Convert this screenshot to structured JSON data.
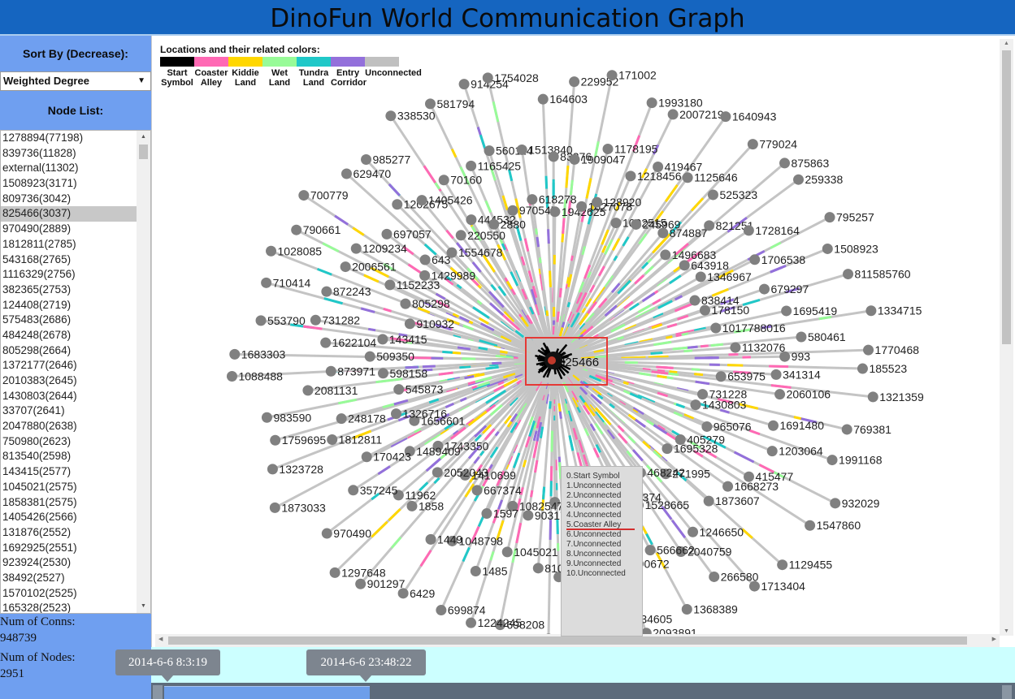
{
  "app": {
    "title": "DinoFun World Communication Graph"
  },
  "sidebar": {
    "sort_label": "Sort By (Decrease):",
    "sort_value": "Weighted Degree",
    "node_list_label": "Node List:",
    "selected_index": 5,
    "nodes": [
      "1278894(77198)",
      "839736(11828)",
      "external(11302)",
      "1508923(3171)",
      "809736(3042)",
      "825466(3037)",
      "970490(2889)",
      "1812811(2785)",
      "543168(2765)",
      "1116329(2756)",
      "382365(2753)",
      "124408(2719)",
      "575483(2686)",
      "484248(2678)",
      "805298(2664)",
      "1372177(2646)",
      "2010383(2645)",
      "1430803(2644)",
      "33707(2641)",
      "2047880(2638)",
      "750980(2623)",
      "813540(2598)",
      "143415(2577)",
      "1045021(2575)",
      "1858381(2575)",
      "1405426(2566)",
      "131876(2552)",
      "1692925(2551)",
      "923924(2530)",
      "38492(2527)",
      "1570102(2525)",
      "165328(2523)"
    ],
    "num_conns_label": "Num of Conns:",
    "num_conns": "948739",
    "num_nodes_label": "Num of Nodes:",
    "num_nodes": "2951"
  },
  "legend": {
    "title": "Locations and their related colors:",
    "items": [
      {
        "line1": "Start",
        "line2": "Symbol",
        "color": "#000000"
      },
      {
        "line1": "Coaster",
        "line2": "Alley",
        "color": "#ff69b4"
      },
      {
        "line1": "Kiddie",
        "line2": "Land",
        "color": "#ffd700"
      },
      {
        "line1": "Wet",
        "line2": "Land",
        "color": "#98fb98"
      },
      {
        "line1": "Tundra",
        "line2": "Land",
        "color": "#20c8c8"
      },
      {
        "line1": "Entry",
        "line2": "Corridor",
        "color": "#9370db"
      },
      {
        "line1": "Unconnected",
        "line2": "",
        "color": "#c0c0c0"
      }
    ]
  },
  "graph": {
    "center_label": "825466",
    "neighbor_labels": [
      "185523",
      "341314",
      "653975",
      "1321359",
      "2060106",
      "731228",
      "769381",
      "1691480",
      "1430803",
      "1991168",
      "1203064",
      "965076",
      "932029",
      "415477",
      "405279",
      "1547860",
      "1668273",
      "1695328",
      "1129455",
      "1873607",
      "271995",
      "1713404",
      "1246650",
      "468242",
      "266580",
      "2040759",
      "1528665",
      "1368389",
      "566662",
      "767374",
      "2093891",
      "1490672",
      "2874",
      "1234605",
      "129457",
      "1020418",
      "1138420",
      "2580",
      "714380",
      "477978",
      "810735",
      "90317",
      "698208",
      "1045021",
      "1082547",
      "1224245",
      "1485",
      "1597",
      "699874",
      "1048798",
      "667374",
      "6429",
      "1449",
      "1410699",
      "901297",
      "1858",
      "2052043",
      "1297648",
      "11962",
      "1743350",
      "970490",
      "357245",
      "1489409",
      "1873033",
      "170423",
      "1656601",
      "1323728",
      "1812811",
      "1326716",
      "1759695",
      "248178",
      "545873",
      "983590",
      "2081131",
      "598158",
      "1088488",
      "873971",
      "509350",
      "1683303",
      "1622104",
      "143415",
      "553790",
      "731282",
      "910932",
      "710414",
      "872243",
      "805298",
      "1028085",
      "2006561",
      "1152233",
      "790661",
      "1209234",
      "1429989",
      "700779",
      "697057",
      "643",
      "629470",
      "1202675",
      "1554678",
      "985277",
      "1405426",
      "220550",
      "338530",
      "70160",
      "444532",
      "581794",
      "1165425",
      "2880",
      "914254",
      "560114",
      "970547",
      "1754028",
      "1513840",
      "618278",
      "164603",
      "83376",
      "1942625",
      "229952",
      "1909047",
      "1027078",
      "171002",
      "1178195",
      "128920",
      "1993180",
      "1218456",
      "1002515",
      "2007219",
      "419467",
      "245969",
      "1640943",
      "1125646",
      "874887",
      "779024",
      "525323",
      "1496683",
      "875863",
      "821251",
      "643918",
      "259338",
      "1728164",
      "1346967",
      "795257",
      "1706538",
      "838414",
      "1508923",
      "679297",
      "178150",
      "811585760",
      "1695419",
      "1017788016",
      "1334715",
      "580461",
      "1132076",
      "1770468",
      "993"
    ]
  },
  "tooltip": {
    "lines": [
      "0.Start Symbol",
      "1.Unconnected",
      "2.Unconnected",
      "3.Unconnected",
      "4.Unconnected",
      "5.Coaster Alley",
      "6.Unconnected",
      "7.Unconnected",
      "8.Unconnected",
      "9.Unconnected",
      "10.Unconnected"
    ]
  },
  "timeline": {
    "start": "2014-6-6 8:3:19",
    "end": "2014-6-6 23:48:22"
  }
}
